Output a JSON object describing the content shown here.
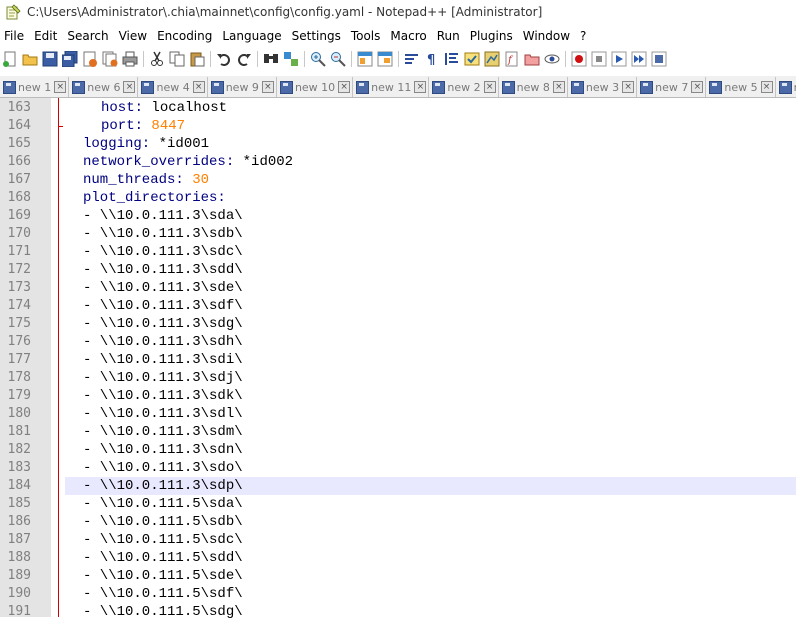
{
  "window": {
    "title": "C:\\Users\\Administrator\\.chia\\mainnet\\config\\config.yaml - Notepad++ [Administrator]"
  },
  "menu": [
    "File",
    "Edit",
    "Search",
    "View",
    "Encoding",
    "Language",
    "Settings",
    "Tools",
    "Macro",
    "Run",
    "Plugins",
    "Window",
    "?"
  ],
  "tabs": [
    "new 1",
    "new 6",
    "new 4",
    "new 9",
    "new 10",
    "new 11",
    "new 2",
    "new 8",
    "new 3",
    "new 7",
    "new 5",
    "ne"
  ],
  "editor": {
    "current_line": 184,
    "lines": [
      {
        "num": "163",
        "indent": "  ",
        "key": "host:",
        "value": " localhost",
        "value_type": "text"
      },
      {
        "num": "164",
        "indent": "  ",
        "key": "port:",
        "value": " 8447",
        "value_type": "number"
      },
      {
        "num": "165",
        "indent": "",
        "key": "logging:",
        "value": " *id001",
        "value_type": "text"
      },
      {
        "num": "166",
        "indent": "",
        "key": "network_overrides:",
        "value": " *id002",
        "value_type": "text"
      },
      {
        "num": "167",
        "indent": "",
        "key": "num_threads:",
        "value": " 30",
        "value_type": "number"
      },
      {
        "num": "168",
        "indent": "",
        "key": "plot_directories:",
        "value": "",
        "value_type": "text"
      },
      {
        "num": "169",
        "indent": "",
        "key": "",
        "value": "- \\\\10.0.111.3\\sda\\",
        "value_type": "text"
      },
      {
        "num": "170",
        "indent": "",
        "key": "",
        "value": "- \\\\10.0.111.3\\sdb\\",
        "value_type": "text"
      },
      {
        "num": "171",
        "indent": "",
        "key": "",
        "value": "- \\\\10.0.111.3\\sdc\\",
        "value_type": "text"
      },
      {
        "num": "172",
        "indent": "",
        "key": "",
        "value": "- \\\\10.0.111.3\\sdd\\",
        "value_type": "text"
      },
      {
        "num": "173",
        "indent": "",
        "key": "",
        "value": "- \\\\10.0.111.3\\sde\\",
        "value_type": "text"
      },
      {
        "num": "174",
        "indent": "",
        "key": "",
        "value": "- \\\\10.0.111.3\\sdf\\",
        "value_type": "text"
      },
      {
        "num": "175",
        "indent": "",
        "key": "",
        "value": "- \\\\10.0.111.3\\sdg\\",
        "value_type": "text"
      },
      {
        "num": "176",
        "indent": "",
        "key": "",
        "value": "- \\\\10.0.111.3\\sdh\\",
        "value_type": "text"
      },
      {
        "num": "177",
        "indent": "",
        "key": "",
        "value": "- \\\\10.0.111.3\\sdi\\",
        "value_type": "text"
      },
      {
        "num": "178",
        "indent": "",
        "key": "",
        "value": "- \\\\10.0.111.3\\sdj\\",
        "value_type": "text"
      },
      {
        "num": "179",
        "indent": "",
        "key": "",
        "value": "- \\\\10.0.111.3\\sdk\\",
        "value_type": "text"
      },
      {
        "num": "180",
        "indent": "",
        "key": "",
        "value": "- \\\\10.0.111.3\\sdl\\",
        "value_type": "text"
      },
      {
        "num": "181",
        "indent": "",
        "key": "",
        "value": "- \\\\10.0.111.3\\sdm\\",
        "value_type": "text"
      },
      {
        "num": "182",
        "indent": "",
        "key": "",
        "value": "- \\\\10.0.111.3\\sdn\\",
        "value_type": "text"
      },
      {
        "num": "183",
        "indent": "",
        "key": "",
        "value": "- \\\\10.0.111.3\\sdo\\",
        "value_type": "text"
      },
      {
        "num": "184",
        "indent": "",
        "key": "",
        "value": "- \\\\10.0.111.3\\sdp\\",
        "value_type": "text"
      },
      {
        "num": "185",
        "indent": "",
        "key": "",
        "value": "- \\\\10.0.111.5\\sda\\",
        "value_type": "text"
      },
      {
        "num": "186",
        "indent": "",
        "key": "",
        "value": "- \\\\10.0.111.5\\sdb\\",
        "value_type": "text"
      },
      {
        "num": "187",
        "indent": "",
        "key": "",
        "value": "- \\\\10.0.111.5\\sdc\\",
        "value_type": "text"
      },
      {
        "num": "188",
        "indent": "",
        "key": "",
        "value": "- \\\\10.0.111.5\\sdd\\",
        "value_type": "text"
      },
      {
        "num": "189",
        "indent": "",
        "key": "",
        "value": "- \\\\10.0.111.5\\sde\\",
        "value_type": "text"
      },
      {
        "num": "190",
        "indent": "",
        "key": "",
        "value": "- \\\\10.0.111.5\\sdf\\",
        "value_type": "text"
      },
      {
        "num": "191",
        "indent": "",
        "key": "",
        "value": "- \\\\10.0.111.5\\sdg\\",
        "value_type": "text"
      }
    ]
  },
  "colors": {
    "key": "#000080",
    "number": "#ff8000",
    "current_line_bg": "#e8e8ff",
    "gutter_bg": "#e4e4e4",
    "fold_line": "#d40000"
  },
  "toolbar_icons": [
    "new-file-icon",
    "open-file-icon",
    "save-icon",
    "save-all-icon",
    "close-icon",
    "close-all-icon",
    "print-icon",
    "cut-icon",
    "copy-icon",
    "paste-icon",
    "undo-icon",
    "redo-icon",
    "find-icon",
    "replace-icon",
    "zoom-in-icon",
    "zoom-out-icon",
    "sync-vertical-icon",
    "sync-horizontal-icon",
    "word-wrap-icon",
    "show-all-chars-icon",
    "indent-guide-icon",
    "user-lang-icon",
    "doc-map-icon",
    "function-list-icon",
    "folder-workspace-icon",
    "monitoring-icon",
    "record-macro-icon",
    "stop-macro-icon",
    "play-macro-icon",
    "run-macro-multiple-icon",
    "save-macro-icon"
  ]
}
